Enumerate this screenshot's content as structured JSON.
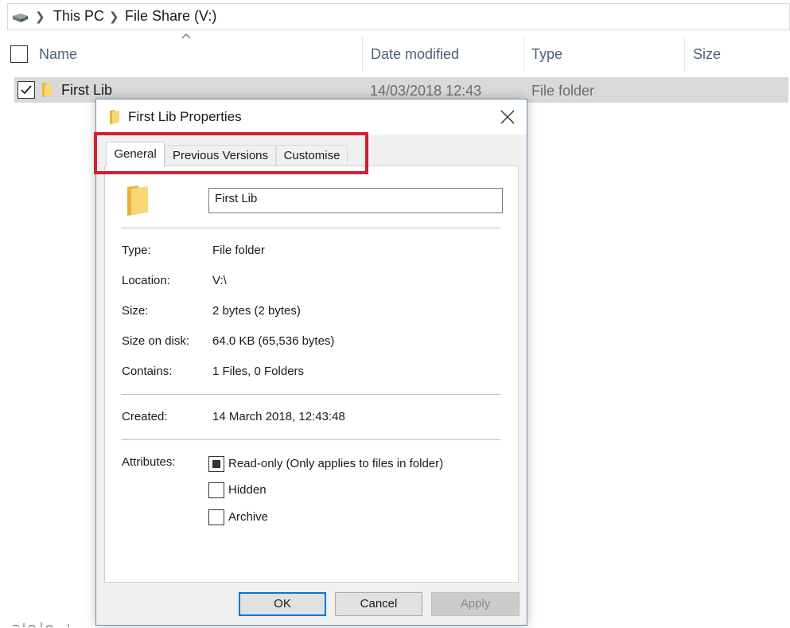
{
  "explorer": {
    "breadcrumb": [
      "This PC",
      "File Share (V:)"
    ],
    "columns": {
      "name": "Name",
      "date_modified": "Date modified",
      "type": "Type",
      "size": "Size"
    },
    "rows": [
      {
        "name": "First Lib",
        "date_modified": "14/03/2018 12:43",
        "type": "File folder",
        "size": "",
        "selected": true
      }
    ]
  },
  "dialog": {
    "title": "First Lib Properties",
    "tabs": [
      "General",
      "Previous Versions",
      "Customise"
    ],
    "active_tab": "General",
    "folder_name": "First Lib",
    "properties": [
      {
        "label": "Type:",
        "value": "File folder"
      },
      {
        "label": "Location:",
        "value": "V:\\"
      },
      {
        "label": "Size:",
        "value": "2 bytes (2 bytes)"
      },
      {
        "label": "Size on disk:",
        "value": "64.0 KB (65,536 bytes)"
      },
      {
        "label": "Contains:",
        "value": "1 Files, 0 Folders"
      }
    ],
    "created": {
      "label": "Created:",
      "value": "14 March 2018, 12:43:48"
    },
    "attributes": {
      "label": "Attributes:",
      "items": [
        {
          "label": "Read-only (Only applies to files in folder)",
          "state": "indeterminate"
        },
        {
          "label": "Hidden",
          "state": "unchecked"
        },
        {
          "label": "Archive",
          "state": "unchecked"
        }
      ]
    },
    "buttons": {
      "ok": "OK",
      "cancel": "Cancel",
      "apply": "Apply"
    }
  },
  "colors": {
    "highlight_box": "#d0202a",
    "column_header_text": "#4c607a",
    "selected_row_bg": "#d9d9d9",
    "folder_yellow": "#f5cd55",
    "default_button_border": "#0078d7"
  },
  "icons": [
    "drive-icon",
    "chevron-right-icon",
    "sort-ascending-icon",
    "folder-icon",
    "checkmark-icon",
    "close-icon"
  ]
}
